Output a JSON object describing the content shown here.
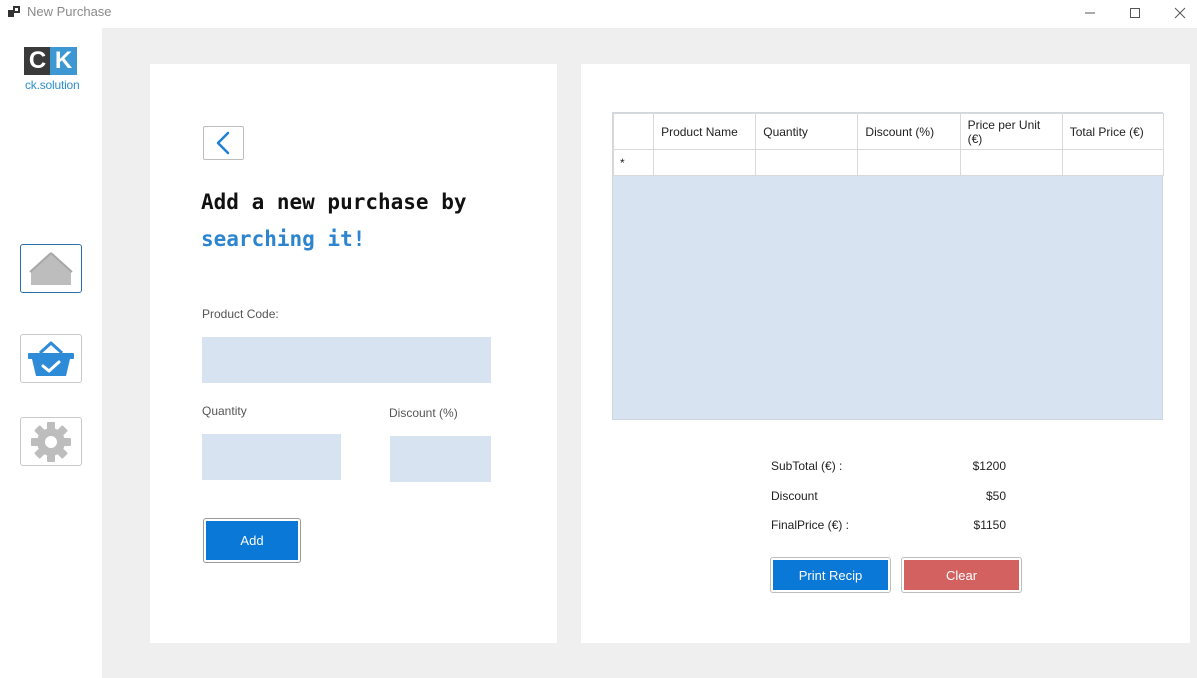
{
  "window": {
    "title": "New Purchase"
  },
  "logo": {
    "letter_c": "C",
    "letter_k": "K",
    "text": "ck.solution"
  },
  "sidebar": {
    "items": [
      {
        "name": "home",
        "icon": "home-icon"
      },
      {
        "name": "purchase",
        "icon": "basket-check-icon"
      },
      {
        "name": "settings",
        "icon": "gear-icon"
      }
    ]
  },
  "form": {
    "headline_line1": "Add a new purchase by",
    "headline_line2": "searching it!",
    "product_code_label": "Product Code:",
    "product_code_value": "",
    "quantity_label": "Quantity",
    "quantity_value": "",
    "discount_label": "Discount (%)",
    "discount_value": "",
    "add_label": "Add"
  },
  "grid": {
    "columns": [
      "Product Name",
      "Quantity",
      "Discount (%)",
      "Price per Unit (€)",
      "Total Price (€)"
    ],
    "new_row_marker": "*",
    "rows": []
  },
  "summary": {
    "subtotal_label": "SubTotal (€) :",
    "subtotal_value": "$1200",
    "discount_label": "Discount",
    "discount_value": "$50",
    "final_label": "FinalPrice (€) :",
    "final_value": "$1150"
  },
  "actions": {
    "print_label": "Print Recip",
    "clear_label": "Clear"
  },
  "colors": {
    "accent_blue": "#0a78d7",
    "clear_red": "#d36160",
    "field_fill": "#d7e3f0",
    "window_bg": "#efefef"
  }
}
